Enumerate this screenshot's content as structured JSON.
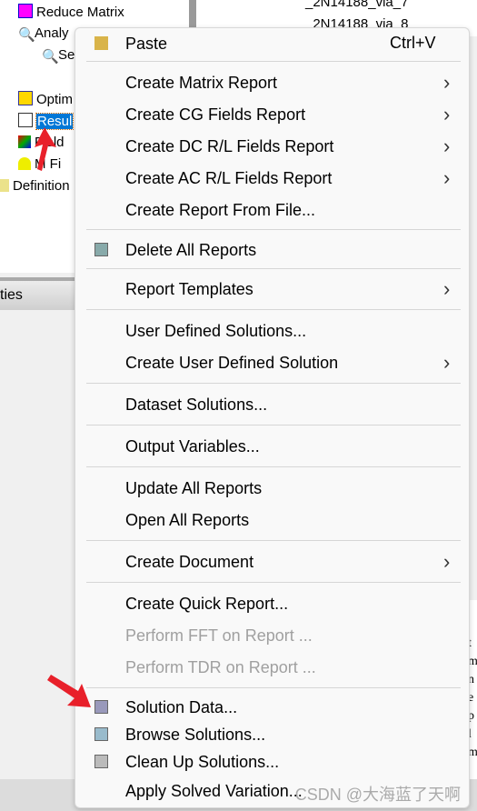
{
  "tree": {
    "items": [
      "Reduce Matrix",
      "Analy",
      "Se",
      "Optim",
      "Resul",
      "Field",
      "M Fi",
      "Definition"
    ]
  },
  "right_tree": {
    "items": [
      "_2N14188_via_7",
      "_2N14188_via_8"
    ]
  },
  "panel": {
    "title": "ties"
  },
  "right_text": [
    "t",
    "m",
    "n",
    "e",
    "p",
    "l",
    "m"
  ],
  "menu": {
    "paste": {
      "label": "Paste",
      "shortcut": "Ctrl+V",
      "icon": "paste-icon"
    },
    "items": [
      {
        "label": "Create Matrix Report",
        "submenu": true
      },
      {
        "label": "Create CG Fields Report",
        "submenu": true
      },
      {
        "label": "Create DC R/L Fields Report",
        "submenu": true
      },
      {
        "label": "Create AC R/L Fields Report",
        "submenu": true
      },
      {
        "label": "Create Report From File..."
      },
      {
        "label": "Delete All Reports",
        "icon": "delete-reports-icon"
      },
      {
        "label": "Report Templates",
        "submenu": true
      },
      {
        "label": "User Defined Solutions..."
      },
      {
        "label": "Create User Defined Solution",
        "submenu": true
      },
      {
        "label": "Dataset Solutions..."
      },
      {
        "label": "Output Variables..."
      },
      {
        "label": "Update All Reports"
      },
      {
        "label": "Open All Reports"
      },
      {
        "label": "Create Document",
        "submenu": true
      },
      {
        "label": "Create Quick Report..."
      },
      {
        "label": "Perform FFT on Report ...",
        "disabled": true
      },
      {
        "label": "Perform TDR on Report ...",
        "disabled": true
      },
      {
        "label": "Solution Data...",
        "icon": "solution-data-icon"
      },
      {
        "label": "Browse Solutions...",
        "icon": "browse-solutions-icon"
      },
      {
        "label": "Clean Up Solutions...",
        "icon": "clean-up-icon"
      },
      {
        "label": "Apply Solved Variation..."
      }
    ]
  },
  "watermark": "CSDN @大海蓝了天啊",
  "colors": {
    "selection": "#0078d7",
    "annotation_arrow": "#e8202a"
  }
}
